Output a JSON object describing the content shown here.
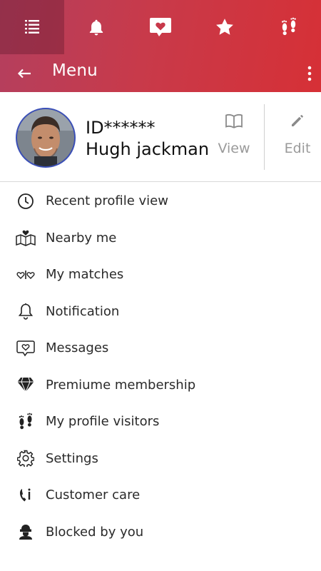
{
  "tabs": [
    {
      "icon": "list-icon",
      "active": true
    },
    {
      "icon": "bell-icon",
      "active": false
    },
    {
      "icon": "heart-message-icon",
      "active": false
    },
    {
      "icon": "star-icon",
      "active": false
    },
    {
      "icon": "footprints-icon",
      "active": false
    }
  ],
  "header": {
    "title": "Menu",
    "back_icon": "back-arrow-icon",
    "more_icon": "more-vert-icon"
  },
  "profile": {
    "id_text": "ID******",
    "name": "Hugh jackman",
    "view_label": "View",
    "edit_label": "Edit"
  },
  "menu": {
    "items": [
      {
        "label": "Recent profile view",
        "icon": "clock-icon"
      },
      {
        "label": "Nearby me",
        "icon": "map-heart-icon"
      },
      {
        "label": "My matches",
        "icon": "match-hearts-icon"
      },
      {
        "label": "Notification",
        "icon": "bell-outline-icon"
      },
      {
        "label": "Messages",
        "icon": "message-heart-icon"
      },
      {
        "label": "Premiume membership",
        "icon": "diamond-icon"
      },
      {
        "label": "My profile visitors",
        "icon": "footprints-icon"
      },
      {
        "label": "Settings",
        "icon": "gear-icon"
      },
      {
        "label": "Customer care",
        "icon": "phone-info-icon"
      },
      {
        "label": "Blocked by you",
        "icon": "blocked-user-icon"
      }
    ]
  },
  "colors": {
    "gradient_start": "#b43f5e",
    "gradient_end": "#d63036",
    "text": "#2a2a2a",
    "muted": "#9a9a9a",
    "avatar_border": "#3a4fb8"
  }
}
